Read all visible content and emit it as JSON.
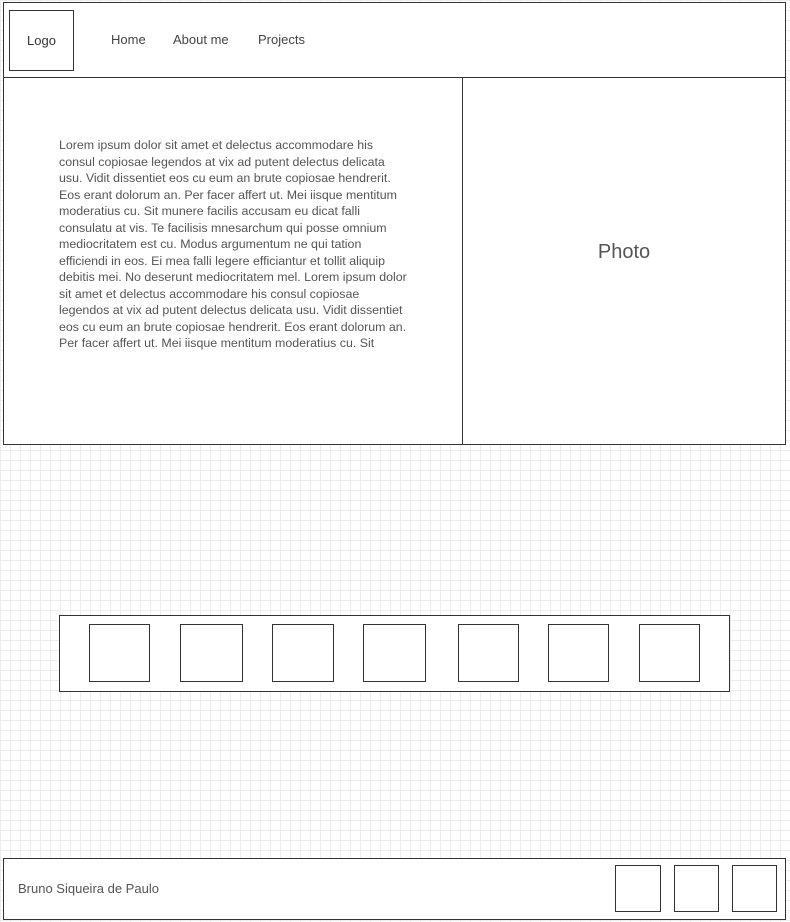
{
  "header": {
    "logo": "Logo",
    "nav": [
      {
        "label": "Home"
      },
      {
        "label": "About me"
      },
      {
        "label": "Projects"
      }
    ]
  },
  "content": {
    "paragraph": "Lorem ipsum dolor sit amet et delectus accommodare his consul copiosae legendos at vix ad putent delectus delicata usu. Vidit dissentiet eos cu eum an brute copiosae hendrerit. Eos erant dolorum an. Per facer affert ut. Mei iisque mentitum moderatius cu. Sit munere facilis accusam eu dicat falli consulatu at vis. Te facilisis mnesarchum qui posse omnium mediocritatem est cu. Modus argumentum ne qui tation efficiendi in eos. Ei mea falli legere efficiantur et tollit aliquip debitis mei. No deserunt mediocritatem mel. Lorem ipsum dolor sit amet et delectus accommodare his consul copiosae legendos at vix ad putent delectus delicata usu. Vidit dissentiet eos cu eum an brute copiosae hendrerit. Eos erant dolorum an. Per facer affert ut. Mei iisque mentitum moderatius cu. Sit",
    "photo_label": "Photo"
  },
  "gallery": {
    "thumbnail_count": 7
  },
  "footer": {
    "name": "Bruno Siqueira de Paulo",
    "social_icon_count": 3
  }
}
